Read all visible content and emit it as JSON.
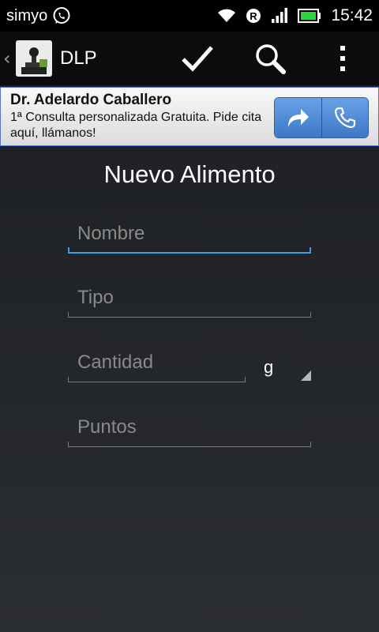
{
  "statusbar": {
    "carrier": "simyo",
    "time": "15:42",
    "icons": [
      "whatsapp-icon",
      "wifi-icon",
      "roaming-r-icon",
      "signal-icon",
      "battery-icon"
    ]
  },
  "actionbar": {
    "title": "DLP",
    "actions": [
      "check-icon",
      "search-icon",
      "overflow-menu-icon"
    ]
  },
  "ad": {
    "title": "Dr. Adelardo Caballero",
    "text": "1ª Consulta personalizada Gratuita. Pide cita aquí, llámanos!",
    "buttons": [
      "share-arrow-icon",
      "phone-icon"
    ]
  },
  "form": {
    "heading": "Nuevo Alimento",
    "nombre_placeholder": "Nombre",
    "tipo_placeholder": "Tipo",
    "cantidad_placeholder": "Cantidad",
    "unit_value": "g",
    "puntos_placeholder": "Puntos"
  },
  "colors": {
    "focus_accent": "#33a4d8",
    "ad_button": "#4a86d4",
    "battery": "#2fd43c"
  }
}
